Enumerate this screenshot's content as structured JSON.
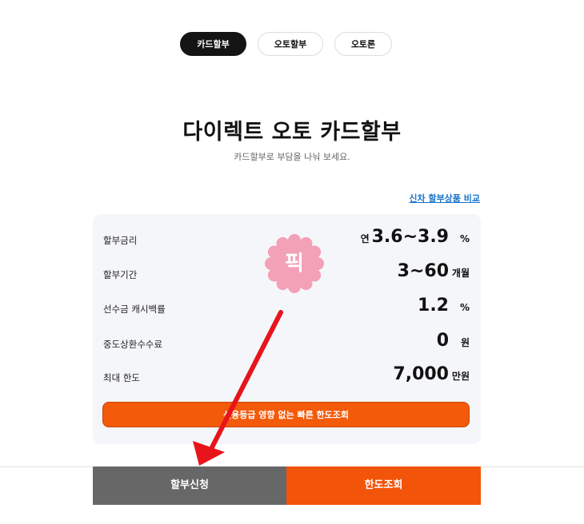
{
  "tabs": [
    {
      "label": "카드할부",
      "active": true
    },
    {
      "label": "오토할부",
      "active": false
    },
    {
      "label": "오토론",
      "active": false
    }
  ],
  "header": {
    "title": "다이렉트 오토 카드할부",
    "subtitle": "카드할부로 부담을 나눠 보세요."
  },
  "compare_link": "신차 할부상품 비교",
  "card": {
    "rows": [
      {
        "label": "할부금리",
        "prefix": "연",
        "value": "3.6~3.9",
        "unit": "%"
      },
      {
        "label": "할부기간",
        "prefix": "",
        "value": "3~60",
        "unit": "개월"
      },
      {
        "label": "선수금 캐시백률",
        "prefix": "",
        "value": "1.2",
        "unit": "%"
      },
      {
        "label": "중도상환수수료",
        "prefix": "",
        "value": "0",
        "unit": "원"
      },
      {
        "label": "최대 한도",
        "prefix": "",
        "value": "7,000",
        "unit": "만원"
      }
    ],
    "limit_button": "신용등급 영향 없는 빠른 한도조회"
  },
  "badge": {
    "text": "픽",
    "color": "#f3a1b6"
  },
  "bottom": {
    "apply_label": "할부신청",
    "limit_label": "한도조회"
  },
  "colors": {
    "accent": "#f25409",
    "annotation_arrow": "#e8141b"
  }
}
